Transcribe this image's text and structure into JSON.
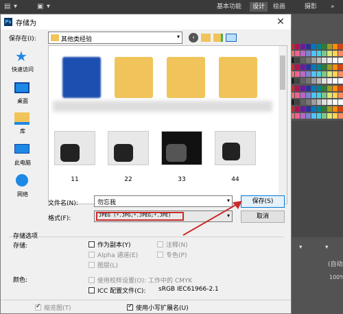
{
  "ps": {
    "toolbar_glyphs": [
      "▤",
      "▾",
      "▣",
      "▾"
    ],
    "workspaces": [
      "基本功能",
      "设计",
      "绘画",
      "摄影",
      "»"
    ],
    "active_workspace": 1,
    "right_glyphs": [
      "▾",
      "▾",
      "(自动",
      "100%"
    ]
  },
  "dialog": {
    "title": "存储为",
    "close": "✕",
    "save_in_label": "保存在(I):",
    "save_in_value": "其他类经验",
    "toolbar_icons": [
      "back-icon",
      "up-folder-icon",
      "new-folder-icon",
      "view-menu-icon"
    ],
    "nav": [
      {
        "label": "快速访问",
        "icon": "star-icon"
      },
      {
        "label": "桌面",
        "icon": "desktop-icon"
      },
      {
        "label": "库",
        "icon": "library-icon"
      },
      {
        "label": "此电脑",
        "icon": "computer-icon"
      },
      {
        "label": "网络",
        "icon": "network-icon"
      }
    ],
    "thumbnails": [
      "11",
      "22",
      "33",
      "44"
    ],
    "filename_label": "文件名(N):",
    "filename_value": "勿忘我",
    "format_label": "格式(F):",
    "format_value": "JPEG (*.JPG;*.JPEG;*.JPE)",
    "save_button": "保存(S)",
    "cancel_button": "取消",
    "options_group": "存储选项",
    "store_label": "存储:",
    "options": [
      {
        "label": "作为副本(Y)",
        "checked": false,
        "enabled": true
      },
      {
        "label": "注释(N)",
        "checked": false,
        "enabled": false
      },
      {
        "label": "Alpha 通道(E)",
        "checked": false,
        "enabled": false
      },
      {
        "label": "专色(P)",
        "checked": false,
        "enabled": false
      },
      {
        "label": "图层(L)",
        "checked": false,
        "enabled": false
      }
    ],
    "color_label": "颜色:",
    "proof_label": "使用校样设置(O): 工作中的 CMYK",
    "icc_label": "ICC 配置文件(C):",
    "icc_value": "sRGB IEC61966-2.1",
    "thumbnail_label": "缩览图(T)",
    "lowercase_ext_label": "使用小写扩展名(U)"
  },
  "colors": {
    "highlight": "#cc2a2a",
    "primary_border": "#0078d7",
    "folder": "#f0c45a",
    "blue_folder": "#1d4fb0"
  }
}
